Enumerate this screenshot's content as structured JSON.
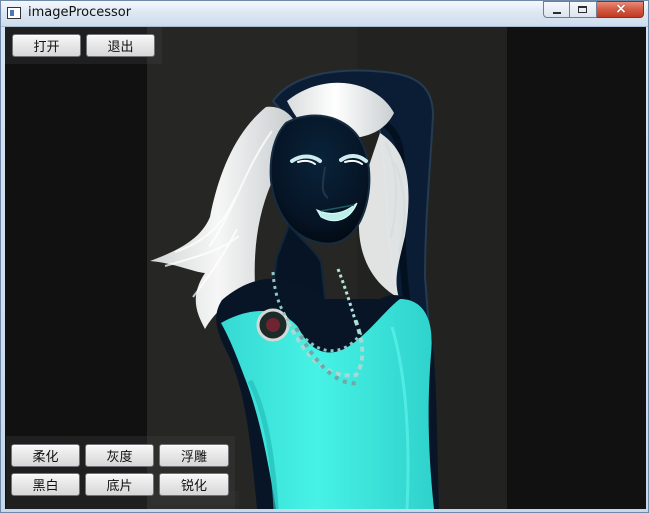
{
  "window": {
    "title": "imageProcessor",
    "caption_buttons": {
      "minimize": "minimize-icon",
      "maximize": "maximize-icon",
      "close": "close-icon"
    }
  },
  "top_buttons": {
    "open": "打开",
    "exit": "退出"
  },
  "filter_buttons": {
    "soften": "柔化",
    "grayscale": "灰度",
    "emboss": "浮雕",
    "black_white": "黑白",
    "negative": "底片",
    "sharpen": "锐化"
  },
  "image": {
    "content": "inverted portrait"
  },
  "colors": {
    "canvas_background": "#111111",
    "photo_background": "#252623",
    "dress_cyan": "#43eee2",
    "hair_white": "#f2f4f3",
    "skin_navy": "#06182a"
  }
}
